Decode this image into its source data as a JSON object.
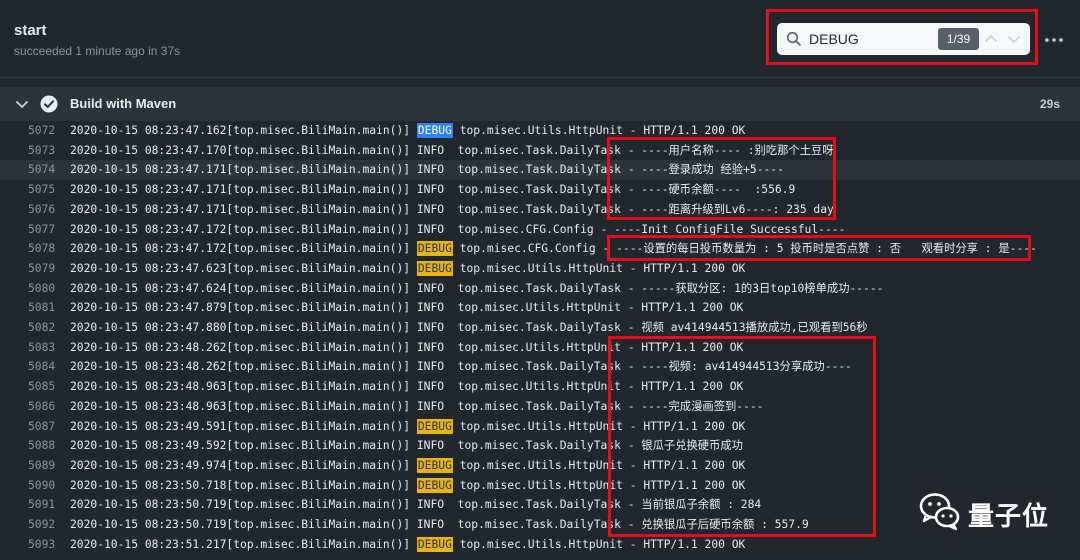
{
  "header": {
    "title": "start",
    "subtitle": "succeeded 1 minute ago in 37s"
  },
  "search": {
    "value": "DEBUG",
    "count": "1/39",
    "icon": "search-icon"
  },
  "step": {
    "title": "Build with Maven",
    "duration": "29s",
    "status_icon": "check-circle-icon"
  },
  "colors": {
    "background": "#22272e",
    "debug_badge": "#e7b416",
    "debug_badge_active": "#2f81f7",
    "annotation_red": "#e3101b"
  },
  "log": {
    "lines": [
      {
        "num": "5072",
        "pre": "2020-10-15 08:23:47.162[top.misec.BiliMain.main()] ",
        "level": "DEBUG",
        "post": " top.misec.Utils.HttpUnit - HTTP/1.1 200 OK"
      },
      {
        "num": "5073",
        "pre": "2020-10-15 08:23:47.170[top.misec.BiliMain.main()] INFO  top.misec.Task.DailyTask - ----用户名称---- :别吃那个土豆呀",
        "level": "",
        "post": ""
      },
      {
        "num": "5074",
        "pre": "2020-10-15 08:23:47.171[top.misec.BiliMain.main()] INFO  top.misec.Task.DailyTask - ----登录成功 经验+5----",
        "level": "",
        "post": ""
      },
      {
        "num": "5075",
        "pre": "2020-10-15 08:23:47.171[top.misec.BiliMain.main()] INFO  top.misec.Task.DailyTask - ----硬币余额----  :556.9",
        "level": "",
        "post": ""
      },
      {
        "num": "5076",
        "pre": "2020-10-15 08:23:47.171[top.misec.BiliMain.main()] INFO  top.misec.Task.DailyTask - ----距离升级到Lv6----: 235 day",
        "level": "",
        "post": ""
      },
      {
        "num": "5077",
        "pre": "2020-10-15 08:23:47.172[top.misec.BiliMain.main()] INFO  top.misec.CFG.Config - ----Init ConfigFile Successful----",
        "level": "",
        "post": ""
      },
      {
        "num": "5078",
        "pre": "2020-10-15 08:23:47.172[top.misec.BiliMain.main()] ",
        "level": "DEBUG",
        "post": " top.misec.CFG.Config - ----设置的每日投币数量为 : 5 投币时是否点赞 : 否   观看时分享 : 是----"
      },
      {
        "num": "5079",
        "pre": "2020-10-15 08:23:47.623[top.misec.BiliMain.main()] ",
        "level": "DEBUG",
        "post": " top.misec.Utils.HttpUnit - HTTP/1.1 200 OK"
      },
      {
        "num": "5080",
        "pre": "2020-10-15 08:23:47.624[top.misec.BiliMain.main()] INFO  top.misec.Task.DailyTask - -----获取分区: 1的3日top10榜单成功-----",
        "level": "",
        "post": ""
      },
      {
        "num": "5081",
        "pre": "2020-10-15 08:23:47.879[top.misec.BiliMain.main()] INFO  top.misec.Utils.HttpUnit - HTTP/1.1 200 OK",
        "level": "",
        "post": ""
      },
      {
        "num": "5082",
        "pre": "2020-10-15 08:23:47.880[top.misec.BiliMain.main()] INFO  top.misec.Task.DailyTask - 视频 av414944513播放成功,已观看到56秒",
        "level": "",
        "post": ""
      },
      {
        "num": "5083",
        "pre": "2020-10-15 08:23:48.262[top.misec.BiliMain.main()] INFO  top.misec.Utils.HttpUnit - HTTP/1.1 200 OK",
        "level": "",
        "post": ""
      },
      {
        "num": "5084",
        "pre": "2020-10-15 08:23:48.262[top.misec.BiliMain.main()] INFO  top.misec.Task.DailyTask - ----视频: av414944513分享成功----",
        "level": "",
        "post": ""
      },
      {
        "num": "5085",
        "pre": "2020-10-15 08:23:48.963[top.misec.BiliMain.main()] INFO  top.misec.Utils.HttpUnit - HTTP/1.1 200 OK",
        "level": "",
        "post": ""
      },
      {
        "num": "5086",
        "pre": "2020-10-15 08:23:48.963[top.misec.BiliMain.main()] INFO  top.misec.Task.DailyTask - ----完成漫画签到----",
        "level": "",
        "post": ""
      },
      {
        "num": "5087",
        "pre": "2020-10-15 08:23:49.591[top.misec.BiliMain.main()] ",
        "level": "DEBUG",
        "post": " top.misec.Utils.HttpUnit - HTTP/1.1 200 OK"
      },
      {
        "num": "5088",
        "pre": "2020-10-15 08:23:49.592[top.misec.BiliMain.main()] INFO  top.misec.Task.DailyTask - 银瓜子兑换硬币成功",
        "level": "",
        "post": ""
      },
      {
        "num": "5089",
        "pre": "2020-10-15 08:23:49.974[top.misec.BiliMain.main()] ",
        "level": "DEBUG",
        "post": " top.misec.Utils.HttpUnit - HTTP/1.1 200 OK"
      },
      {
        "num": "5090",
        "pre": "2020-10-15 08:23:50.718[top.misec.BiliMain.main()] ",
        "level": "DEBUG",
        "post": " top.misec.Utils.HttpUnit - HTTP/1.1 200 OK"
      },
      {
        "num": "5091",
        "pre": "2020-10-15 08:23:50.719[top.misec.BiliMain.main()] INFO  top.misec.Task.DailyTask - 当前银瓜子余额 : 284",
        "level": "",
        "post": ""
      },
      {
        "num": "5092",
        "pre": "2020-10-15 08:23:50.719[top.misec.BiliMain.main()] INFO  top.misec.Task.DailyTask - 兑换银瓜子后硬币余额 : 557.9",
        "level": "",
        "post": ""
      },
      {
        "num": "5093",
        "pre": "2020-10-15 08:23:51.217[top.misec.BiliMain.main()] ",
        "level": "DEBUG",
        "post": " top.misec.Utils.HttpUnit - HTTP/1.1 200 OK"
      }
    ]
  },
  "watermark": {
    "text": "量子位",
    "icon": "wechat-logo-icon"
  }
}
